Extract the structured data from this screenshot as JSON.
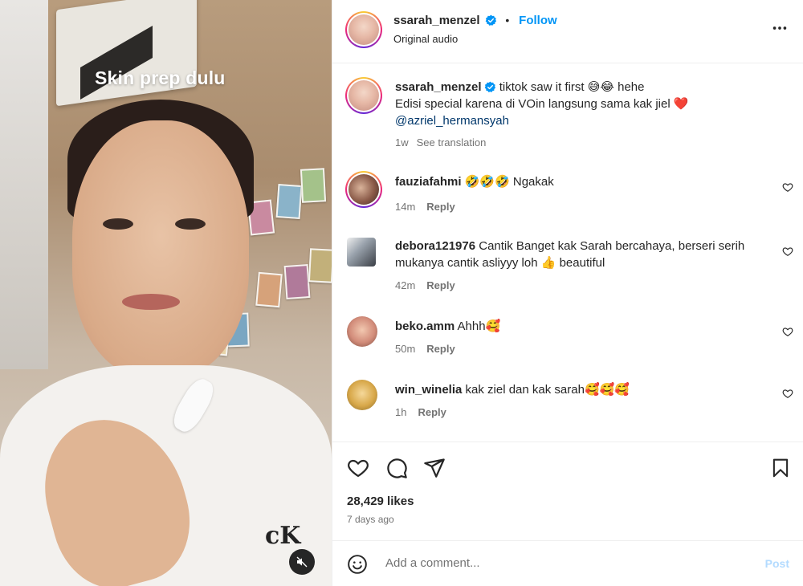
{
  "video": {
    "overlay_text": "Skin prep dulu",
    "brand_logo": "cK",
    "mute_icon": "muted-speaker-icon"
  },
  "header": {
    "username": "ssarah_menzel",
    "separator": "•",
    "follow_label": "Follow",
    "subtitle": "Original audio",
    "more_icon": "more-horizontal-icon"
  },
  "caption": {
    "username": "ssarah_menzel",
    "line1_before": " tiktok saw it first ",
    "line1_emoji": "😅😂",
    "line1_after": " hehe",
    "line2": "Edisi special karena di VOin langsung sama kak jiel ",
    "line2_emoji": "❤️",
    "mention": "@azriel_hermansyah",
    "time": "1w",
    "translate_label": "See translation"
  },
  "comments": [
    {
      "username": "fauziafahmi",
      "text": "🤣🤣🤣 Ngakak",
      "time": "14m",
      "reply_label": "Reply"
    },
    {
      "username": "debora121976",
      "text": "Cantik Banget kak Sarah bercahaya, berseri serih mukanya cantik asliyyy loh 👍 beautiful",
      "time": "42m",
      "reply_label": "Reply"
    },
    {
      "username": "beko.amm",
      "text": "Ahhh🥰",
      "time": "50m",
      "reply_label": "Reply"
    },
    {
      "username": "win_winelia",
      "text": "kak ziel dan kak sarah🥰🥰🥰",
      "time": "1h",
      "reply_label": "Reply"
    }
  ],
  "actions": {
    "like_icon": "heart-icon",
    "comment_icon": "comment-bubble-icon",
    "share_icon": "paper-plane-icon",
    "save_icon": "bookmark-icon",
    "likes_label": "28,429 likes",
    "date_label": "7 days ago"
  },
  "comment_box": {
    "emoji_icon": "emoji-smile-icon",
    "placeholder": "Add a comment...",
    "post_label": "Post"
  },
  "colors": {
    "link_blue": "#0095f6",
    "muted_text": "#737373",
    "primary_text": "#262626",
    "disabled_post": "#b3dbff",
    "verified_blue": "#0095f6"
  }
}
